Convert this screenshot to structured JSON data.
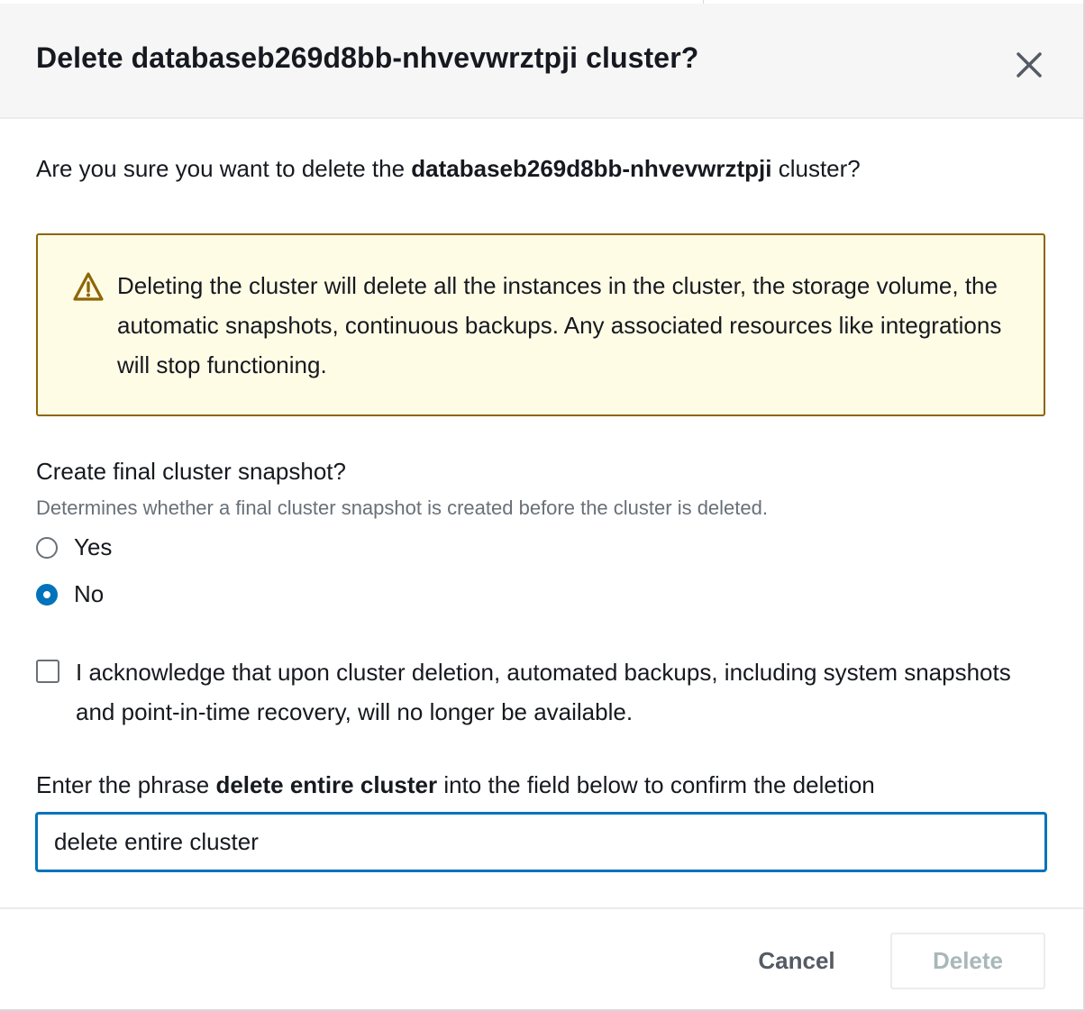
{
  "dialog": {
    "title": "Delete databaseb269d8bb-nhvevwrztpji cluster?",
    "close_icon": "close-icon"
  },
  "confirm": {
    "prefix": "Are you sure you want to delete the ",
    "cluster_name": "databaseb269d8bb-nhvevwrztpji",
    "suffix": " cluster?"
  },
  "alert": {
    "icon": "warning-icon",
    "text": "Deleting the cluster will delete all the instances in the cluster, the storage volume, the automatic snapshots, continuous backups. Any associated resources like integrations will stop functioning."
  },
  "snapshot": {
    "label": "Create final cluster snapshot?",
    "description": "Determines whether a final cluster snapshot is created before the cluster is deleted.",
    "options": [
      {
        "label": "Yes",
        "checked": false
      },
      {
        "label": "No",
        "checked": true
      }
    ]
  },
  "acknowledge": {
    "checked": false,
    "text": "I acknowledge that upon cluster deletion, automated backups, including system snapshots and point-in-time recovery, will no longer be available."
  },
  "phrase": {
    "prefix": "Enter the phrase ",
    "phrase": "delete entire cluster",
    "suffix": " into the field below to confirm the deletion",
    "input_value": "delete entire cluster"
  },
  "footer": {
    "cancel_label": "Cancel",
    "delete_label": "Delete"
  },
  "colors": {
    "accent": "#0073bb",
    "warning_border": "#8d6605",
    "warning_bg": "#fffce6",
    "disabled_text": "#aab7b8"
  }
}
